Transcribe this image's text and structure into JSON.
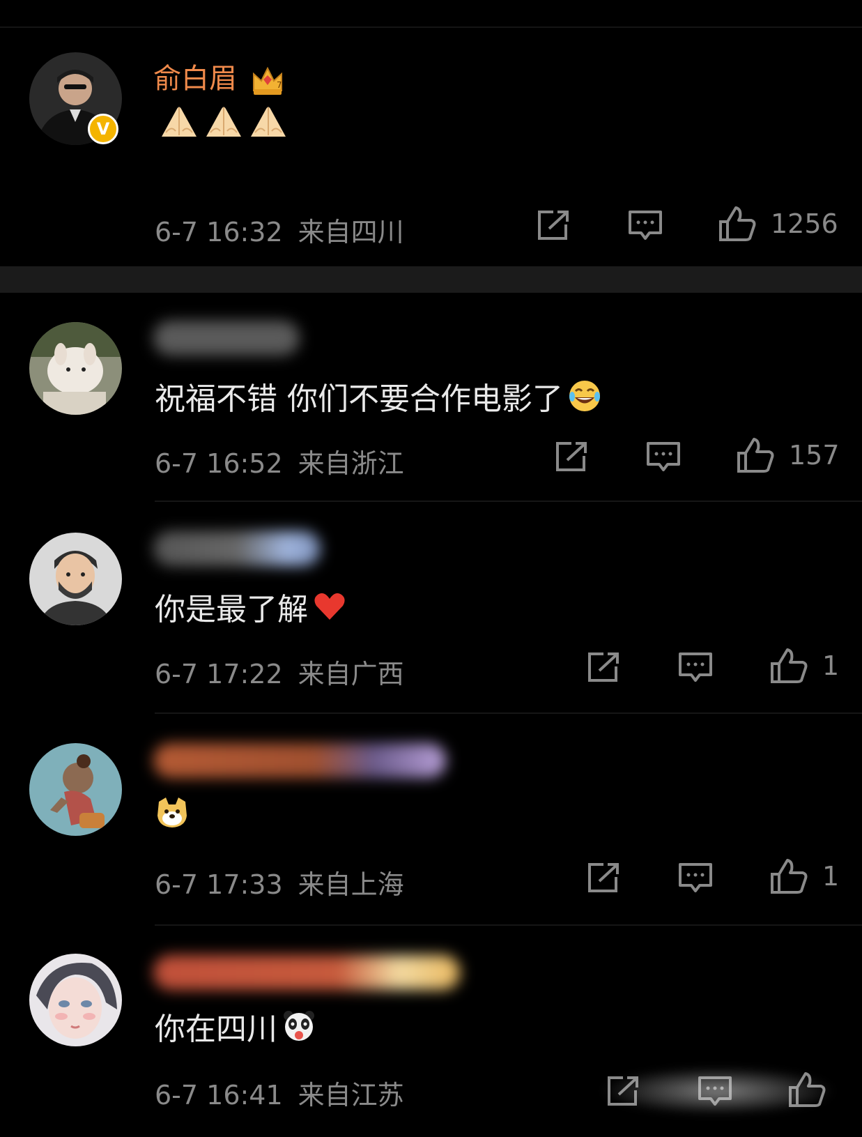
{
  "colors": {
    "background": "#000000",
    "username": "#f08a4b",
    "meta": "#8a8a8a",
    "content": "#e9e9e9",
    "verified_badge": "#f4b400"
  },
  "comments": [
    {
      "username": "俞白眉",
      "username_badge_icon": "crown-badge-icon",
      "verified": true,
      "verified_mark": "V",
      "content": "",
      "content_emoji": [
        "pray-icon",
        "pray-icon",
        "pray-icon"
      ],
      "time": "6-7 16:32",
      "location": "来自四川",
      "likes": "1256"
    },
    {
      "username_blurred": true,
      "content": "祝福不错 你们不要合作电影了",
      "content_emoji": [
        "laughing-tears-icon"
      ],
      "time": "6-7 16:52",
      "location": "来自浙江",
      "likes": "157"
    },
    {
      "username_blurred": true,
      "content": "你是最了解",
      "content_emoji": [
        "red-heart-icon"
      ],
      "time": "6-7 17:22",
      "location": "来自广西",
      "likes": "1"
    },
    {
      "username_blurred": true,
      "content": "",
      "content_emoji": [
        "doge-icon"
      ],
      "time": "6-7 17:33",
      "location": "来自上海",
      "likes": "1"
    },
    {
      "username_blurred": true,
      "content": "你在四川",
      "content_emoji": [
        "panda-face-icon"
      ],
      "time": "6-7 16:41",
      "location": "来自江苏",
      "likes": ""
    }
  ]
}
